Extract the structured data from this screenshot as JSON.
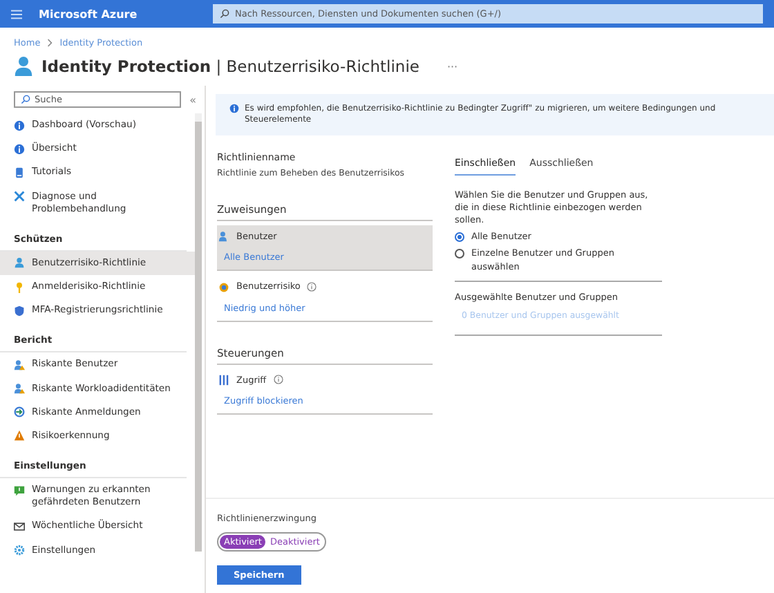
{
  "topbar": {
    "brand": "Microsoft Azure",
    "search_placeholder": "Nach Ressourcen, Diensten und Dokumenten suchen (G+/)"
  },
  "breadcrumb": [
    "Home",
    "Identity Protection"
  ],
  "title": {
    "main": "Identity Protection",
    "separator": "|",
    "sub": "Benutzerrisiko-Richtlinie",
    "more": "···"
  },
  "sidebar": {
    "search_placeholder": "Suche",
    "collapse": "«",
    "sections": [
      {
        "items": [
          {
            "kind": "info",
            "label": "Dashboard (Vorschau)",
            "selected": false
          },
          {
            "kind": "info",
            "label": "Übersicht",
            "selected": false
          },
          {
            "kind": "book",
            "label": "Tutorials",
            "selected": false
          },
          {
            "kind": "tools",
            "label": "Diagnose und Problembehandlung",
            "selected": false
          }
        ]
      },
      {
        "heading": "Schützen",
        "items": [
          {
            "kind": "user",
            "label": "Benutzerrisiko-Richtlinie",
            "selected": true
          },
          {
            "kind": "key",
            "label": "Anmelderisiko-Richtlinie",
            "selected": false
          },
          {
            "kind": "shield",
            "label": "MFA-Registrierungsrichtlinie",
            "selected": false
          }
        ]
      },
      {
        "heading": "Bericht",
        "items": [
          {
            "kind": "users",
            "label": "Riskante Benutzer",
            "selected": false
          },
          {
            "kind": "users",
            "label": "Riskante Workloadidentitäten",
            "selected": false
          },
          {
            "kind": "signin",
            "label": "Riskante Anmeldungen",
            "selected": false
          },
          {
            "kind": "warning",
            "label": "Risikoerkennung",
            "selected": false
          }
        ]
      },
      {
        "heading": "Einstellungen",
        "items": [
          {
            "kind": "alert",
            "label": "Warnungen zu erkannten gefährdeten Benutzern",
            "selected": false
          },
          {
            "kind": "mail",
            "label": "Wöchentliche Übersicht",
            "selected": false
          },
          {
            "kind": "gear",
            "label": "Einstellungen",
            "selected": false
          }
        ]
      }
    ]
  },
  "banner": {
    "text": "Es wird empfohlen, die Benutzerrisiko-Richtlinie zu Bedingter Zugriff\" zu migrieren, um weitere Bedingungen und Steuerelemente"
  },
  "policy_name": {
    "label": "Richtlinienname",
    "value": "Richtlinie zum Beheben des Benutzerrisikos"
  },
  "assignments": {
    "heading": "Zuweisungen",
    "items": [
      {
        "kind": "users",
        "label": "Benutzer",
        "value": "Alle Benutzer",
        "info": false,
        "selected": true
      },
      {
        "kind": "risk",
        "label": "Benutzerrisiko",
        "value": "Niedrig und höher",
        "info": true,
        "selected": false
      }
    ]
  },
  "controls": {
    "heading": "Steuerungen",
    "items": [
      {
        "kind": "access",
        "label": "Zugriff",
        "value": "Zugriff blockieren",
        "info": true,
        "selected": false
      }
    ]
  },
  "tabs": [
    {
      "label": "Einschließen",
      "selected": true
    },
    {
      "label": "Ausschließen",
      "selected": false
    }
  ],
  "include": {
    "description": "Wählen Sie die Benutzer und Gruppen aus, die in diese Richtlinie einbezogen werden sollen.",
    "options": [
      {
        "label": "Alle Benutzer",
        "selected": true
      },
      {
        "label": "Einzelne Benutzer und Gruppen auswählen",
        "selected": false
      }
    ],
    "selected_heading": "Ausgewählte Benutzer und Gruppen",
    "selected_value": "0 Benutzer und Gruppen ausgewählt"
  },
  "enforcement": {
    "label": "Richtlinienerzwingung",
    "options": [
      {
        "label": "Aktiviert",
        "selected": true
      },
      {
        "label": "Deaktiviert",
        "selected": false
      }
    ]
  },
  "save_button": "Speichern"
}
